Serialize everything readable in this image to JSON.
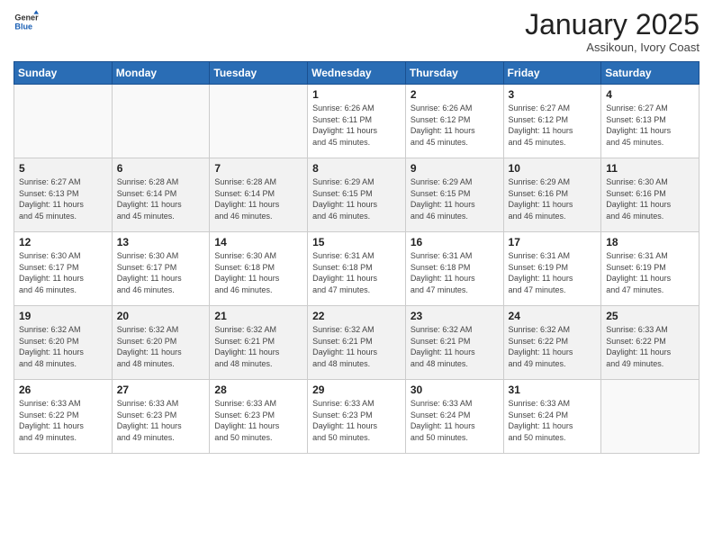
{
  "header": {
    "logo_general": "General",
    "logo_blue": "Blue",
    "month_title": "January 2025",
    "location": "Assikoun, Ivory Coast"
  },
  "weekdays": [
    "Sunday",
    "Monday",
    "Tuesday",
    "Wednesday",
    "Thursday",
    "Friday",
    "Saturday"
  ],
  "weeks": [
    [
      {
        "day": "",
        "info": ""
      },
      {
        "day": "",
        "info": ""
      },
      {
        "day": "",
        "info": ""
      },
      {
        "day": "1",
        "info": "Sunrise: 6:26 AM\nSunset: 6:11 PM\nDaylight: 11 hours\nand 45 minutes."
      },
      {
        "day": "2",
        "info": "Sunrise: 6:26 AM\nSunset: 6:12 PM\nDaylight: 11 hours\nand 45 minutes."
      },
      {
        "day": "3",
        "info": "Sunrise: 6:27 AM\nSunset: 6:12 PM\nDaylight: 11 hours\nand 45 minutes."
      },
      {
        "day": "4",
        "info": "Sunrise: 6:27 AM\nSunset: 6:13 PM\nDaylight: 11 hours\nand 45 minutes."
      }
    ],
    [
      {
        "day": "5",
        "info": "Sunrise: 6:27 AM\nSunset: 6:13 PM\nDaylight: 11 hours\nand 45 minutes."
      },
      {
        "day": "6",
        "info": "Sunrise: 6:28 AM\nSunset: 6:14 PM\nDaylight: 11 hours\nand 45 minutes."
      },
      {
        "day": "7",
        "info": "Sunrise: 6:28 AM\nSunset: 6:14 PM\nDaylight: 11 hours\nand 46 minutes."
      },
      {
        "day": "8",
        "info": "Sunrise: 6:29 AM\nSunset: 6:15 PM\nDaylight: 11 hours\nand 46 minutes."
      },
      {
        "day": "9",
        "info": "Sunrise: 6:29 AM\nSunset: 6:15 PM\nDaylight: 11 hours\nand 46 minutes."
      },
      {
        "day": "10",
        "info": "Sunrise: 6:29 AM\nSunset: 6:16 PM\nDaylight: 11 hours\nand 46 minutes."
      },
      {
        "day": "11",
        "info": "Sunrise: 6:30 AM\nSunset: 6:16 PM\nDaylight: 11 hours\nand 46 minutes."
      }
    ],
    [
      {
        "day": "12",
        "info": "Sunrise: 6:30 AM\nSunset: 6:17 PM\nDaylight: 11 hours\nand 46 minutes."
      },
      {
        "day": "13",
        "info": "Sunrise: 6:30 AM\nSunset: 6:17 PM\nDaylight: 11 hours\nand 46 minutes."
      },
      {
        "day": "14",
        "info": "Sunrise: 6:30 AM\nSunset: 6:18 PM\nDaylight: 11 hours\nand 46 minutes."
      },
      {
        "day": "15",
        "info": "Sunrise: 6:31 AM\nSunset: 6:18 PM\nDaylight: 11 hours\nand 47 minutes."
      },
      {
        "day": "16",
        "info": "Sunrise: 6:31 AM\nSunset: 6:18 PM\nDaylight: 11 hours\nand 47 minutes."
      },
      {
        "day": "17",
        "info": "Sunrise: 6:31 AM\nSunset: 6:19 PM\nDaylight: 11 hours\nand 47 minutes."
      },
      {
        "day": "18",
        "info": "Sunrise: 6:31 AM\nSunset: 6:19 PM\nDaylight: 11 hours\nand 47 minutes."
      }
    ],
    [
      {
        "day": "19",
        "info": "Sunrise: 6:32 AM\nSunset: 6:20 PM\nDaylight: 11 hours\nand 48 minutes."
      },
      {
        "day": "20",
        "info": "Sunrise: 6:32 AM\nSunset: 6:20 PM\nDaylight: 11 hours\nand 48 minutes."
      },
      {
        "day": "21",
        "info": "Sunrise: 6:32 AM\nSunset: 6:21 PM\nDaylight: 11 hours\nand 48 minutes."
      },
      {
        "day": "22",
        "info": "Sunrise: 6:32 AM\nSunset: 6:21 PM\nDaylight: 11 hours\nand 48 minutes."
      },
      {
        "day": "23",
        "info": "Sunrise: 6:32 AM\nSunset: 6:21 PM\nDaylight: 11 hours\nand 48 minutes."
      },
      {
        "day": "24",
        "info": "Sunrise: 6:32 AM\nSunset: 6:22 PM\nDaylight: 11 hours\nand 49 minutes."
      },
      {
        "day": "25",
        "info": "Sunrise: 6:33 AM\nSunset: 6:22 PM\nDaylight: 11 hours\nand 49 minutes."
      }
    ],
    [
      {
        "day": "26",
        "info": "Sunrise: 6:33 AM\nSunset: 6:22 PM\nDaylight: 11 hours\nand 49 minutes."
      },
      {
        "day": "27",
        "info": "Sunrise: 6:33 AM\nSunset: 6:23 PM\nDaylight: 11 hours\nand 49 minutes."
      },
      {
        "day": "28",
        "info": "Sunrise: 6:33 AM\nSunset: 6:23 PM\nDaylight: 11 hours\nand 50 minutes."
      },
      {
        "day": "29",
        "info": "Sunrise: 6:33 AM\nSunset: 6:23 PM\nDaylight: 11 hours\nand 50 minutes."
      },
      {
        "day": "30",
        "info": "Sunrise: 6:33 AM\nSunset: 6:24 PM\nDaylight: 11 hours\nand 50 minutes."
      },
      {
        "day": "31",
        "info": "Sunrise: 6:33 AM\nSunset: 6:24 PM\nDaylight: 11 hours\nand 50 minutes."
      },
      {
        "day": "",
        "info": ""
      }
    ]
  ]
}
